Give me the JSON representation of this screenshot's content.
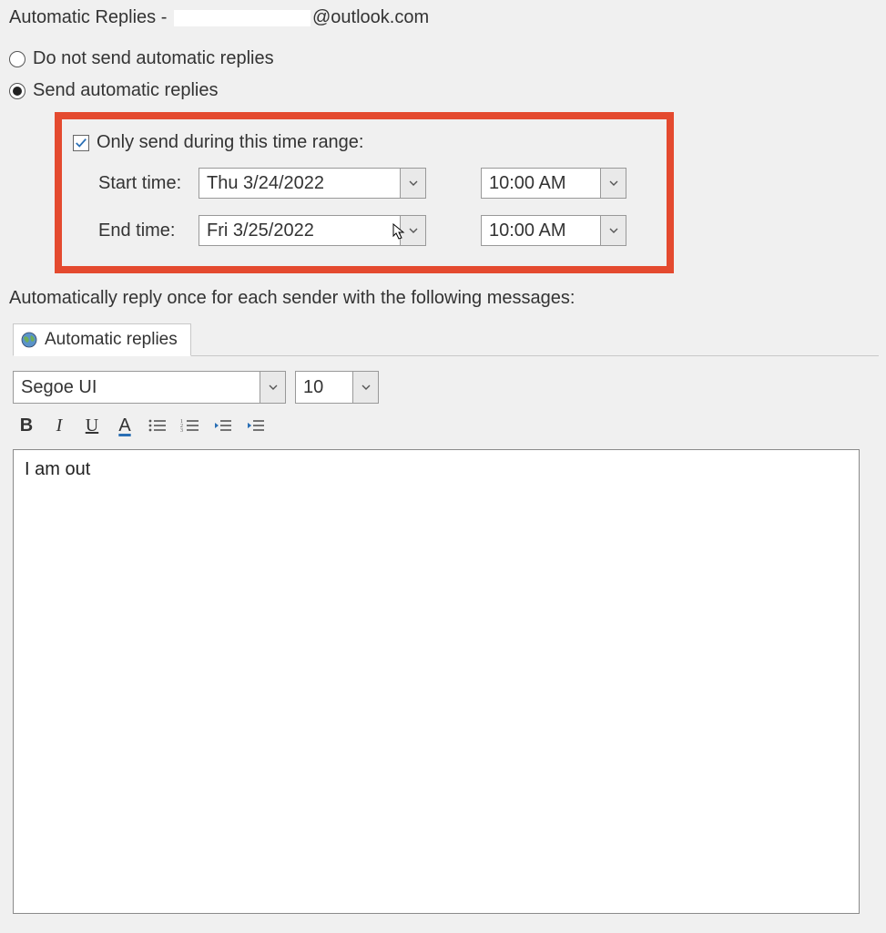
{
  "title": {
    "prefix": "Automatic Replies - ",
    "suffix": "@outlook.com"
  },
  "options": {
    "do_not_send_label": "Do not send automatic replies",
    "send_label": "Send automatic replies",
    "selected": "send"
  },
  "time_range": {
    "checkbox_label": "Only send during this time range:",
    "checked": true,
    "start_label": "Start time:",
    "start_date": "Thu 3/24/2022",
    "start_time": "10:00 AM",
    "end_label": "End time:",
    "end_date": "Fri 3/25/2022",
    "end_time": "10:00 AM"
  },
  "instruction": "Automatically reply once for each sender with the following messages:",
  "tab": {
    "label": "Automatic replies"
  },
  "editor": {
    "font_name": "Segoe UI",
    "font_size": "10",
    "bold_label": "B",
    "italic_label": "I",
    "underline_label": "U",
    "fontcolor_label": "A"
  },
  "message_body": "I am out"
}
